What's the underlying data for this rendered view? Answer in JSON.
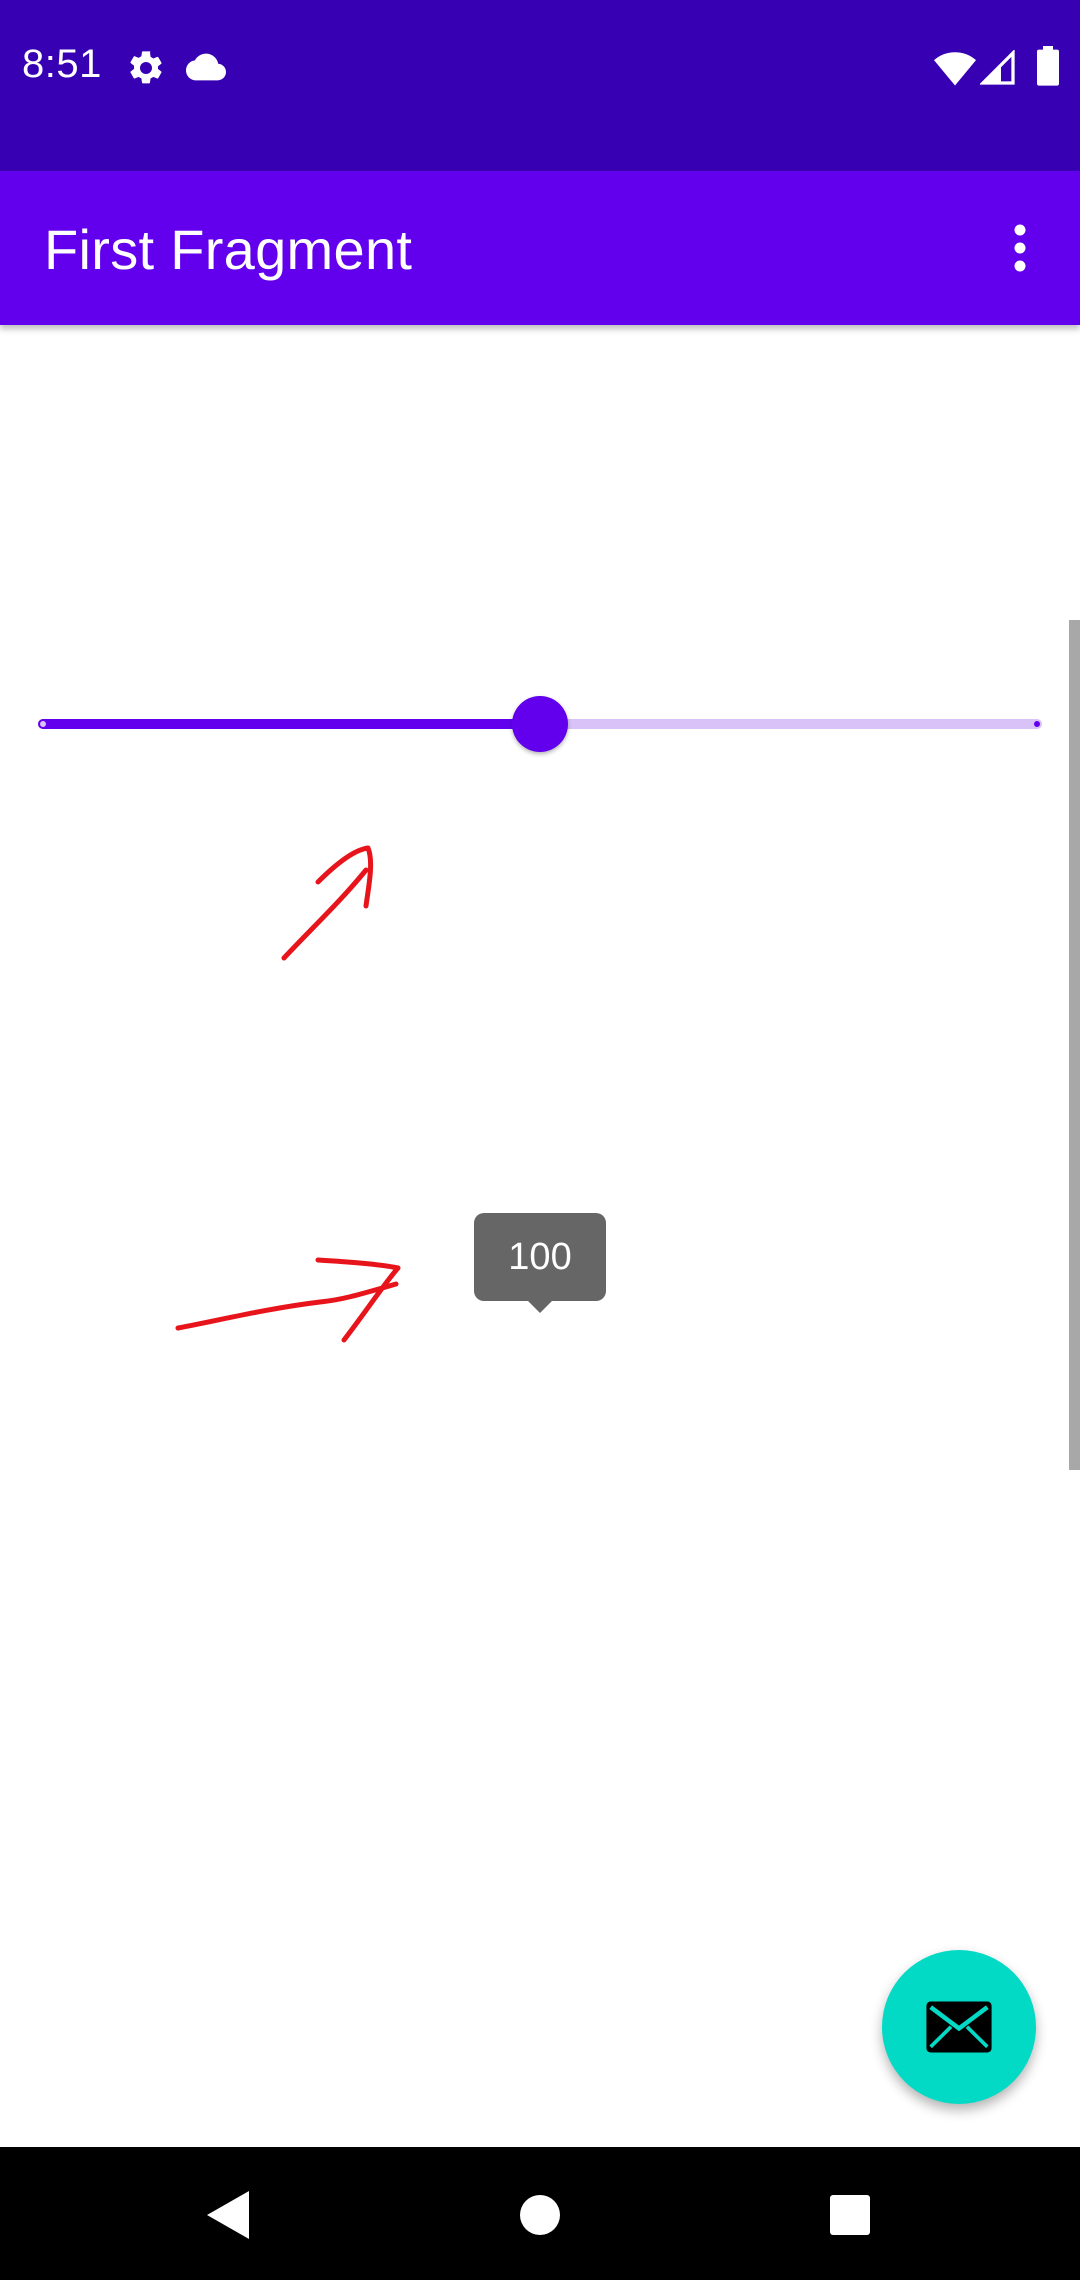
{
  "status_bar": {
    "time": "8:51",
    "icons": [
      "gear-icon",
      "cloud-icon",
      "wifi-icon",
      "signal-icon",
      "battery-icon"
    ]
  },
  "app_bar": {
    "title": "First Fragment",
    "overflow_icon": "more-vert-icon"
  },
  "slider": {
    "min": 0,
    "max": 200,
    "value": 100,
    "tick_count": 2,
    "active_color": "#6200EE",
    "inactive_color": "#D9C2F7"
  },
  "tooltip": {
    "value": "100"
  },
  "fab": {
    "icon": "email-icon",
    "color": "#03DAC5"
  },
  "nav_bar": {
    "buttons": [
      "back-icon",
      "home-icon",
      "recents-icon"
    ]
  },
  "colors": {
    "status_bar": "#3700B3",
    "app_bar": "#6200EE",
    "annotation": "#E8141B"
  }
}
